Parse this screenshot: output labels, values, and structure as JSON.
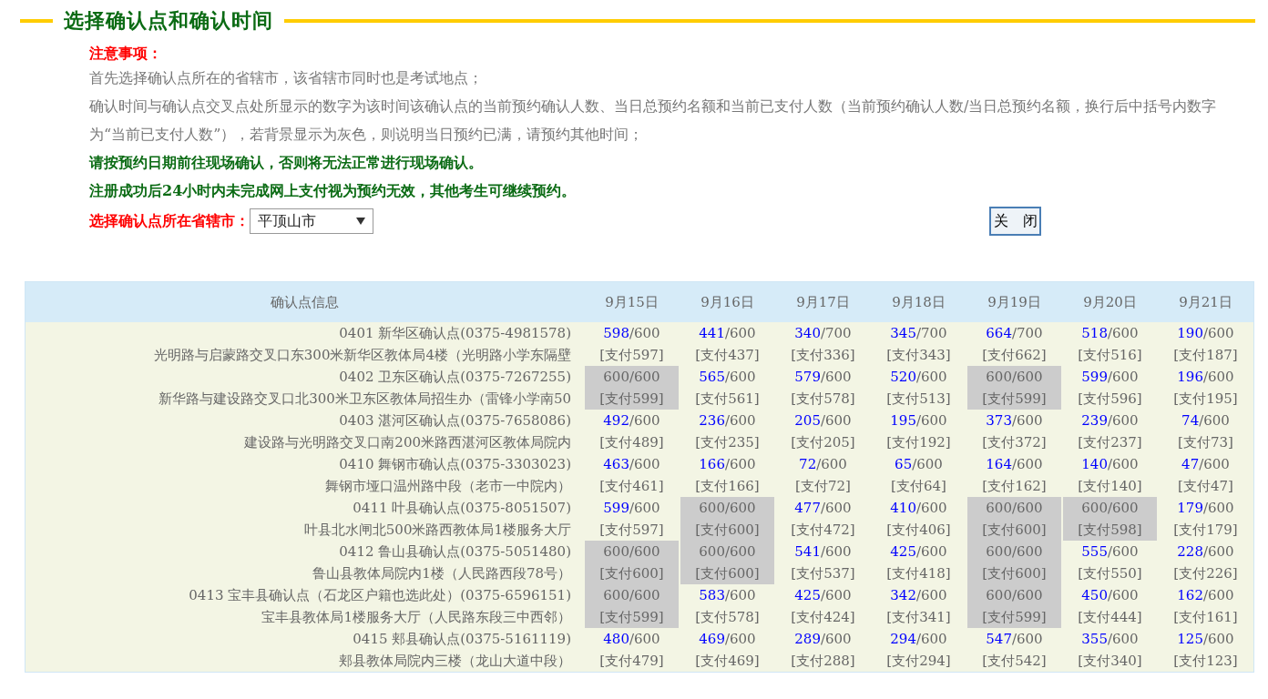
{
  "heading": "选择确认点和确认时间",
  "notes": {
    "title": "注意事项：",
    "lines": [
      {
        "kind": "plain",
        "text": "首先选择确认点所在的省辖市，该省辖市同时也是考试地点；"
      },
      {
        "kind": "plain",
        "text": "确认时间与确认点交叉点处所显示的数字为该时间该确认点的当前预约确认人数、当日总预约名额和当前已支付人数（当前预约确认人数/当日总预约名额，换行后中括号内数字为“当前已支付人数”），若背景显示为灰色，则说明当日预约已满，请预约其他时间；"
      },
      {
        "kind": "emphasis",
        "text": "请按预约日期前往现场确认，否则将无法正常进行现场确认。"
      },
      {
        "kind": "emphasis",
        "text": "注册成功后24小时内未完成网上支付视为预约无效，其他考生可继续预约。"
      }
    ]
  },
  "city_select": {
    "label": "选择确认点所在省辖市：",
    "value": "平顶山市"
  },
  "close_button": "关　闭",
  "table": {
    "columns": [
      "确认点信息",
      "9月15日",
      "9月16日",
      "9月17日",
      "9月18日",
      "9月19日",
      "9月20日",
      "9月21日"
    ],
    "rows": [
      {
        "cells": [
          {
            "kind": "info",
            "name": "0401  新华区确认点(0375-4981578)",
            "address": "光明路与启蒙路交叉口东300米新华区教体局4楼（光明路小学东隔壁"
          },
          {
            "kind": "slot",
            "booked": "598",
            "quota": "/600",
            "paid": "[支付597]",
            "full": false
          },
          {
            "kind": "slot",
            "booked": "441",
            "quota": "/600",
            "paid": "[支付437]",
            "full": false
          },
          {
            "kind": "slot",
            "booked": "340",
            "quota": "/700",
            "paid": "[支付336]",
            "full": false
          },
          {
            "kind": "slot",
            "booked": "345",
            "quota": "/700",
            "paid": "[支付343]",
            "full": false
          },
          {
            "kind": "slot",
            "booked": "664",
            "quota": "/700",
            "paid": "[支付662]",
            "full": false
          },
          {
            "kind": "slot",
            "booked": "518",
            "quota": "/600",
            "paid": "[支付516]",
            "full": false
          },
          {
            "kind": "slot",
            "booked": "190",
            "quota": "/600",
            "paid": "[支付187]",
            "full": false
          }
        ]
      },
      {
        "cells": [
          {
            "kind": "info",
            "name": "0402  卫东区确认点(0375-7267255)",
            "address": "新华路与建设路交叉口北300米卫东区教体局招生办（雷锋小学南50"
          },
          {
            "kind": "slot",
            "booked": "600",
            "quota": "/600",
            "paid": "[支付599]",
            "full": true
          },
          {
            "kind": "slot",
            "booked": "565",
            "quota": "/600",
            "paid": "[支付561]",
            "full": false
          },
          {
            "kind": "slot",
            "booked": "579",
            "quota": "/600",
            "paid": "[支付578]",
            "full": false
          },
          {
            "kind": "slot",
            "booked": "520",
            "quota": "/600",
            "paid": "[支付513]",
            "full": false
          },
          {
            "kind": "slot",
            "booked": "600",
            "quota": "/600",
            "paid": "[支付599]",
            "full": true
          },
          {
            "kind": "slot",
            "booked": "599",
            "quota": "/600",
            "paid": "[支付596]",
            "full": false
          },
          {
            "kind": "slot",
            "booked": "196",
            "quota": "/600",
            "paid": "[支付195]",
            "full": false
          }
        ]
      },
      {
        "cells": [
          {
            "kind": "info",
            "name": "0403  湛河区确认点(0375-7658086)",
            "address": "建设路与光明路交叉口南200米路西湛河区教体局院内"
          },
          {
            "kind": "slot",
            "booked": "492",
            "quota": "/600",
            "paid": "[支付489]",
            "full": false
          },
          {
            "kind": "slot",
            "booked": "236",
            "quota": "/600",
            "paid": "[支付235]",
            "full": false
          },
          {
            "kind": "slot",
            "booked": "205",
            "quota": "/600",
            "paid": "[支付205]",
            "full": false
          },
          {
            "kind": "slot",
            "booked": "195",
            "quota": "/600",
            "paid": "[支付192]",
            "full": false
          },
          {
            "kind": "slot",
            "booked": "373",
            "quota": "/600",
            "paid": "[支付372]",
            "full": false
          },
          {
            "kind": "slot",
            "booked": "239",
            "quota": "/600",
            "paid": "[支付237]",
            "full": false
          },
          {
            "kind": "slot",
            "booked": "74",
            "quota": "/600",
            "paid": "[支付73]",
            "full": false
          }
        ]
      },
      {
        "cells": [
          {
            "kind": "info",
            "name": "0410  舞钢市确认点(0375-3303023)",
            "address": "舞钢市垭口温州路中段（老市一中院内）"
          },
          {
            "kind": "slot",
            "booked": "463",
            "quota": "/600",
            "paid": "[支付461]",
            "full": false
          },
          {
            "kind": "slot",
            "booked": "166",
            "quota": "/600",
            "paid": "[支付166]",
            "full": false
          },
          {
            "kind": "slot",
            "booked": "72",
            "quota": "/600",
            "paid": "[支付72]",
            "full": false
          },
          {
            "kind": "slot",
            "booked": "65",
            "quota": "/600",
            "paid": "[支付64]",
            "full": false
          },
          {
            "kind": "slot",
            "booked": "164",
            "quota": "/600",
            "paid": "[支付162]",
            "full": false
          },
          {
            "kind": "slot",
            "booked": "140",
            "quota": "/600",
            "paid": "[支付140]",
            "full": false
          },
          {
            "kind": "slot",
            "booked": "47",
            "quota": "/600",
            "paid": "[支付47]",
            "full": false
          }
        ]
      },
      {
        "cells": [
          {
            "kind": "info",
            "name": "0411  叶县确认点(0375-8051507)",
            "address": "叶县北水闸北500米路西教体局1楼服务大厅"
          },
          {
            "kind": "slot",
            "booked": "599",
            "quota": "/600",
            "paid": "[支付597]",
            "full": false
          },
          {
            "kind": "slot",
            "booked": "600",
            "quota": "/600",
            "paid": "[支付600]",
            "full": true
          },
          {
            "kind": "slot",
            "booked": "477",
            "quota": "/600",
            "paid": "[支付472]",
            "full": false
          },
          {
            "kind": "slot",
            "booked": "410",
            "quota": "/600",
            "paid": "[支付406]",
            "full": false
          },
          {
            "kind": "slot",
            "booked": "600",
            "quota": "/600",
            "paid": "[支付600]",
            "full": true
          },
          {
            "kind": "slot",
            "booked": "600",
            "quota": "/600",
            "paid": "[支付598]",
            "full": true
          },
          {
            "kind": "slot",
            "booked": "179",
            "quota": "/600",
            "paid": "[支付179]",
            "full": false
          }
        ]
      },
      {
        "cells": [
          {
            "kind": "info",
            "name": "0412  鲁山县确认点(0375-5051480)",
            "address": "鲁山县教体局院内1楼（人民路西段78号）"
          },
          {
            "kind": "slot",
            "booked": "600",
            "quota": "/600",
            "paid": "[支付600]",
            "full": true
          },
          {
            "kind": "slot",
            "booked": "600",
            "quota": "/600",
            "paid": "[支付600]",
            "full": true
          },
          {
            "kind": "slot",
            "booked": "541",
            "quota": "/600",
            "paid": "[支付537]",
            "full": false
          },
          {
            "kind": "slot",
            "booked": "425",
            "quota": "/600",
            "paid": "[支付418]",
            "full": false
          },
          {
            "kind": "slot",
            "booked": "600",
            "quota": "/600",
            "paid": "[支付600]",
            "full": true
          },
          {
            "kind": "slot",
            "booked": "555",
            "quota": "/600",
            "paid": "[支付550]",
            "full": false
          },
          {
            "kind": "slot",
            "booked": "228",
            "quota": "/600",
            "paid": "[支付226]",
            "full": false
          }
        ]
      },
      {
        "cells": [
          {
            "kind": "info",
            "name": "0413  宝丰县确认点（石龙区户籍也选此处）(0375-6596151)",
            "address": "宝丰县教体局1楼服务大厅（人民路东段三中西邻）"
          },
          {
            "kind": "slot",
            "booked": "600",
            "quota": "/600",
            "paid": "[支付599]",
            "full": true
          },
          {
            "kind": "slot",
            "booked": "583",
            "quota": "/600",
            "paid": "[支付578]",
            "full": false
          },
          {
            "kind": "slot",
            "booked": "425",
            "quota": "/600",
            "paid": "[支付424]",
            "full": false
          },
          {
            "kind": "slot",
            "booked": "342",
            "quota": "/600",
            "paid": "[支付341]",
            "full": false
          },
          {
            "kind": "slot",
            "booked": "600",
            "quota": "/600",
            "paid": "[支付599]",
            "full": true
          },
          {
            "kind": "slot",
            "booked": "450",
            "quota": "/600",
            "paid": "[支付444]",
            "full": false
          },
          {
            "kind": "slot",
            "booked": "162",
            "quota": "/600",
            "paid": "[支付161]",
            "full": false
          }
        ]
      },
      {
        "cells": [
          {
            "kind": "info",
            "name": "0415  郏县确认点(0375-5161119)",
            "address": "郏县教体局院内三楼（龙山大道中段）"
          },
          {
            "kind": "slot",
            "booked": "480",
            "quota": "/600",
            "paid": "[支付479]",
            "full": false
          },
          {
            "kind": "slot",
            "booked": "469",
            "quota": "/600",
            "paid": "[支付469]",
            "full": false
          },
          {
            "kind": "slot",
            "booked": "289",
            "quota": "/600",
            "paid": "[支付288]",
            "full": false
          },
          {
            "kind": "slot",
            "booked": "294",
            "quota": "/600",
            "paid": "[支付294]",
            "full": false
          },
          {
            "kind": "slot",
            "booked": "547",
            "quota": "/600",
            "paid": "[支付542]",
            "full": false
          },
          {
            "kind": "slot",
            "booked": "355",
            "quota": "/600",
            "paid": "[支付340]",
            "full": false
          },
          {
            "kind": "slot",
            "booked": "125",
            "quota": "/600",
            "paid": "[支付123]",
            "full": false
          }
        ]
      }
    ]
  }
}
